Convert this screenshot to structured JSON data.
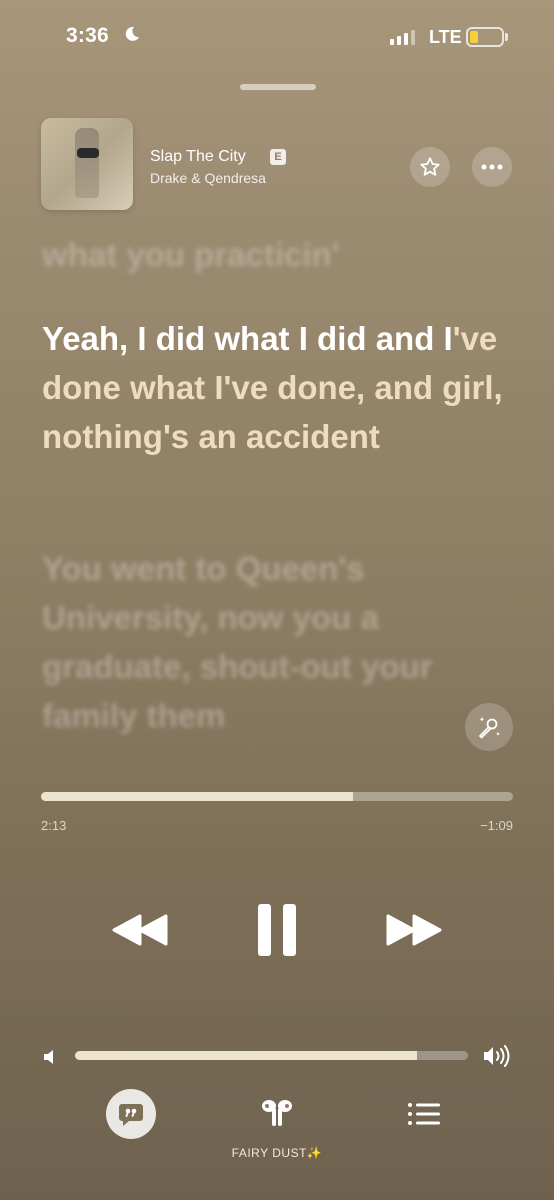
{
  "status_bar": {
    "time": "3:36",
    "network": "LTE",
    "battery_level": 0.2
  },
  "now_playing": {
    "title": "Slap The City",
    "explicit_badge": "E",
    "artist": "Drake & Qendresa"
  },
  "lyrics": {
    "previous": "what you practicin'",
    "current_sung": "Yeah, I did what I did and I",
    "current_unsung": "'ve done what I've done, and girl, nothing's an accident",
    "next": "You went to Queen's University, now you a graduate, shout-out your family them"
  },
  "progress": {
    "elapsed": "2:13",
    "remaining": "−1:09",
    "fraction": 0.66
  },
  "volume": {
    "fraction": 0.87
  },
  "output_device": {
    "name": "FAIRY DUST✨"
  },
  "colors": {
    "accent_fill": "#ede3d1",
    "unsung_lyric": "#eedcc0",
    "battery": "#f3d13a"
  }
}
